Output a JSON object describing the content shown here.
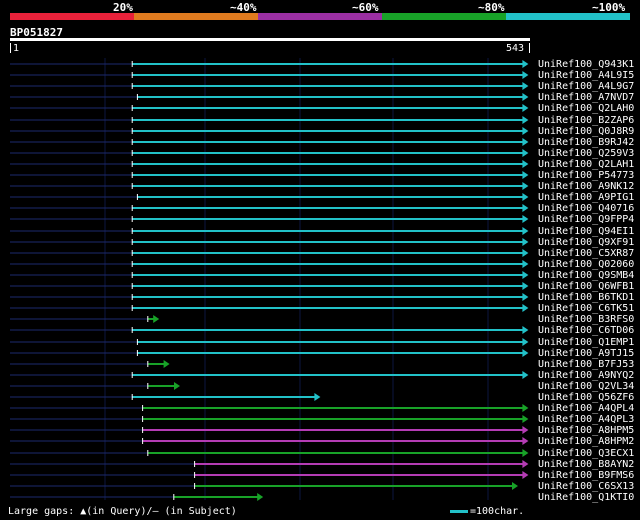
{
  "scale": {
    "labels": [
      "20%",
      "~40%",
      "~60%",
      "~80%",
      "~100%"
    ],
    "colors": [
      "#e8213a",
      "#e07b1f",
      "#9b2fa3",
      "#18a228",
      "#22c1c8"
    ]
  },
  "query": {
    "name": "BP051827",
    "start": "1",
    "end": "543"
  },
  "colors": {
    "cyan": "#22c1c8",
    "green": "#18a228",
    "magenta": "#b43cb4",
    "navy": "#1c2a6e"
  },
  "hits": [
    {
      "name": "UniRef100_Q943K1",
      "color": "cyan",
      "start_frac": 0.235,
      "end_frac": 0.995
    },
    {
      "name": "UniRef100_A4L9I5",
      "color": "cyan",
      "start_frac": 0.235,
      "end_frac": 0.995
    },
    {
      "name": "UniRef100_A4L9G7",
      "color": "cyan",
      "start_frac": 0.235,
      "end_frac": 0.995
    },
    {
      "name": "UniRef100_A7NVD7",
      "color": "cyan",
      "start_frac": 0.245,
      "end_frac": 0.995
    },
    {
      "name": "UniRef100_Q2LAH0",
      "color": "cyan",
      "start_frac": 0.235,
      "end_frac": 0.995
    },
    {
      "name": "UniRef100_B2ZAP6",
      "color": "cyan",
      "start_frac": 0.235,
      "end_frac": 0.995
    },
    {
      "name": "UniRef100_Q0J8R9",
      "color": "cyan",
      "start_frac": 0.235,
      "end_frac": 0.995
    },
    {
      "name": "UniRef100_B9RJ42",
      "color": "cyan",
      "start_frac": 0.235,
      "end_frac": 0.995
    },
    {
      "name": "UniRef100_Q259V3",
      "color": "cyan",
      "start_frac": 0.235,
      "end_frac": 0.995
    },
    {
      "name": "UniRef100_Q2LAH1",
      "color": "cyan",
      "start_frac": 0.235,
      "end_frac": 0.995
    },
    {
      "name": "UniRef100_P54773",
      "color": "cyan",
      "start_frac": 0.235,
      "end_frac": 0.995
    },
    {
      "name": "UniRef100_A9NK12",
      "color": "cyan",
      "start_frac": 0.235,
      "end_frac": 0.995
    },
    {
      "name": "UniRef100_A9PIG1",
      "color": "cyan",
      "start_frac": 0.245,
      "end_frac": 0.995
    },
    {
      "name": "UniRef100_Q40716",
      "color": "cyan",
      "start_frac": 0.235,
      "end_frac": 0.995
    },
    {
      "name": "UniRef100_Q9FPP4",
      "color": "cyan",
      "start_frac": 0.235,
      "end_frac": 0.995
    },
    {
      "name": "UniRef100_Q94EI1",
      "color": "cyan",
      "start_frac": 0.235,
      "end_frac": 0.995
    },
    {
      "name": "UniRef100_Q9XF91",
      "color": "cyan",
      "start_frac": 0.235,
      "end_frac": 0.995
    },
    {
      "name": "UniRef100_C5XR87",
      "color": "cyan",
      "start_frac": 0.235,
      "end_frac": 0.995
    },
    {
      "name": "UniRef100_Q02060",
      "color": "cyan",
      "start_frac": 0.235,
      "end_frac": 0.995
    },
    {
      "name": "UniRef100_Q9SMB4",
      "color": "cyan",
      "start_frac": 0.235,
      "end_frac": 0.995
    },
    {
      "name": "UniRef100_Q6WFB1",
      "color": "cyan",
      "start_frac": 0.235,
      "end_frac": 0.995
    },
    {
      "name": "UniRef100_B6TKD1",
      "color": "cyan",
      "start_frac": 0.235,
      "end_frac": 0.995
    },
    {
      "name": "UniRef100_C6TK51",
      "color": "cyan",
      "start_frac": 0.235,
      "end_frac": 0.995
    },
    {
      "name": "UniRef100_B3RFS0",
      "color": "green",
      "start_frac": 0.265,
      "end_frac": 0.285
    },
    {
      "name": "UniRef100_C6TD06",
      "color": "cyan",
      "start_frac": 0.235,
      "end_frac": 0.995
    },
    {
      "name": "UniRef100_Q1EMP1",
      "color": "cyan",
      "start_frac": 0.245,
      "end_frac": 0.995
    },
    {
      "name": "UniRef100_A9TJ15",
      "color": "cyan",
      "start_frac": 0.245,
      "end_frac": 0.995
    },
    {
      "name": "UniRef100_B7FJ53",
      "color": "green",
      "start_frac": 0.265,
      "end_frac": 0.305
    },
    {
      "name": "UniRef100_A9NYQ2",
      "color": "cyan",
      "start_frac": 0.235,
      "end_frac": 0.995
    },
    {
      "name": "UniRef100_Q2VL34",
      "color": "green",
      "start_frac": 0.265,
      "end_frac": 0.325
    },
    {
      "name": "UniRef100_Q56ZF6",
      "color": "cyan",
      "start_frac": 0.235,
      "end_frac": 0.595
    },
    {
      "name": "UniRef100_A4QPL4",
      "color": "green",
      "start_frac": 0.255,
      "end_frac": 0.995
    },
    {
      "name": "UniRef100_A4QPL3",
      "color": "green",
      "start_frac": 0.255,
      "end_frac": 0.995
    },
    {
      "name": "UniRef100_A8HPM5",
      "color": "magenta",
      "start_frac": 0.255,
      "end_frac": 0.995
    },
    {
      "name": "UniRef100_A8HPM2",
      "color": "magenta",
      "start_frac": 0.255,
      "end_frac": 0.995
    },
    {
      "name": "UniRef100_Q3ECX1",
      "color": "green",
      "start_frac": 0.265,
      "end_frac": 0.995
    },
    {
      "name": "UniRef100_B8AYN2",
      "color": "magenta",
      "start_frac": 0.355,
      "end_frac": 0.995
    },
    {
      "name": "UniRef100_B9FMS6",
      "color": "magenta",
      "start_frac": 0.355,
      "end_frac": 0.995
    },
    {
      "name": "UniRef100_C6SX13",
      "color": "green",
      "start_frac": 0.355,
      "end_frac": 0.975
    },
    {
      "name": "UniRef100_Q1KTI0",
      "color": "green",
      "start_frac": 0.315,
      "end_frac": 0.485
    }
  ],
  "footer": {
    "gaps_text": "Large gaps: ▲(in Query)/— (in Subject)",
    "legend_text": "=100char."
  }
}
